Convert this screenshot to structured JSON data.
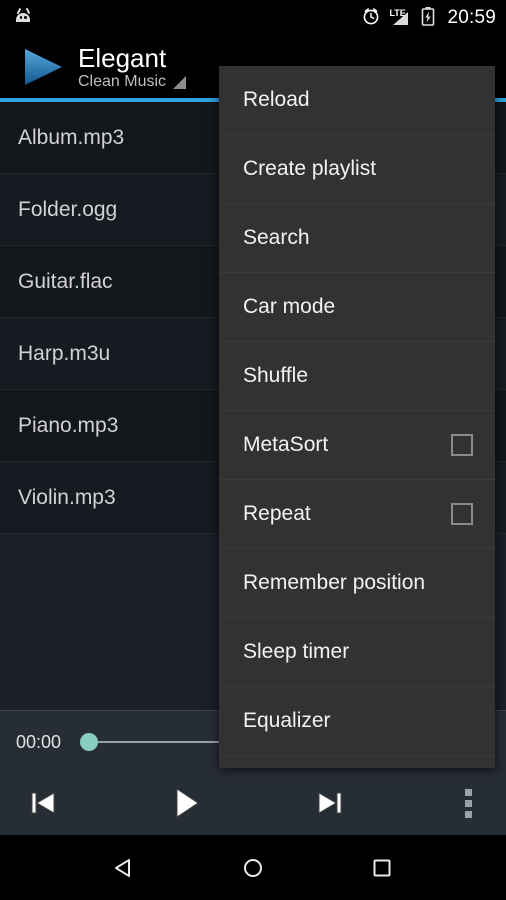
{
  "status_bar": {
    "notification_icon": "android-head-icon",
    "alarm_icon": "alarm-clock-icon",
    "network_label": "LTE",
    "signal_icon": "signal-bars-icon",
    "battery_icon": "battery-charging-icon",
    "clock": "20:59"
  },
  "action_bar": {
    "logo_icon": "play-triangle-logo",
    "title": "Elegant",
    "subtitle": "Clean Music",
    "spinner_icon": "dropdown-triangle-icon",
    "accent_color": "#2ea3dd"
  },
  "file_list": {
    "items": [
      {
        "name": "Album.mp3"
      },
      {
        "name": "Folder.ogg"
      },
      {
        "name": "Guitar.flac"
      },
      {
        "name": "Harp.m3u"
      },
      {
        "name": "Piano.mp3"
      },
      {
        "name": "Violin.mp3"
      }
    ]
  },
  "player": {
    "elapsed_time": "00:00",
    "seek_position_percent": 0,
    "thumb_color": "#88cec3",
    "controls": [
      {
        "name": "previous-button",
        "icon": "skip-previous-icon"
      },
      {
        "name": "play-button",
        "icon": "play-icon"
      },
      {
        "name": "next-button",
        "icon": "skip-next-icon"
      },
      {
        "name": "overflow-button",
        "icon": "overflow-menu-icon"
      }
    ]
  },
  "overflow_menu": {
    "items": [
      {
        "label": "Reload",
        "checkbox": false
      },
      {
        "label": "Create playlist",
        "checkbox": false
      },
      {
        "label": "Search",
        "checkbox": false
      },
      {
        "label": "Car mode",
        "checkbox": false
      },
      {
        "label": "Shuffle",
        "checkbox": false
      },
      {
        "label": "MetaSort",
        "checkbox": true,
        "checked": false
      },
      {
        "label": "Repeat",
        "checkbox": true,
        "checked": false
      },
      {
        "label": "Remember position",
        "checkbox": false
      },
      {
        "label": "Sleep timer",
        "checkbox": false
      },
      {
        "label": "Equalizer",
        "checkbox": false
      }
    ]
  },
  "nav_bar": {
    "back": "back-triangle-icon",
    "home": "home-circle-icon",
    "recents": "recents-square-icon"
  }
}
